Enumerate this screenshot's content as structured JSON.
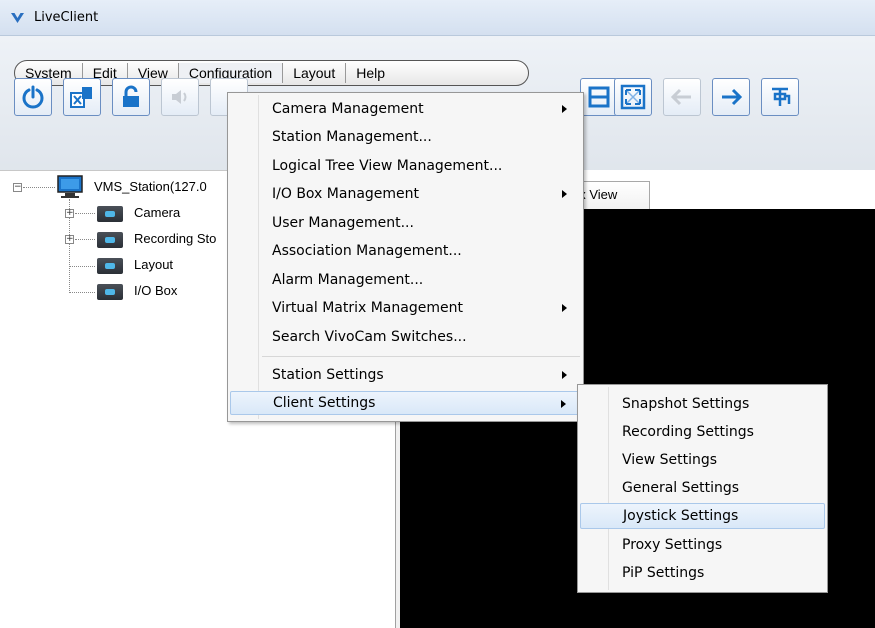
{
  "window": {
    "title": "LiveClient"
  },
  "menubar": {
    "items": [
      "System",
      "Edit",
      "View",
      "Configuration",
      "Layout",
      "Help"
    ]
  },
  "tree": {
    "root": "VMS_Station(127.0",
    "children": [
      "Camera",
      "Recording Sto",
      "Layout",
      "I/O Box"
    ]
  },
  "view_tab": {
    "label": "rix View"
  },
  "config_menu": {
    "items": [
      {
        "label": "Camera Management",
        "submenu": true
      },
      {
        "label": "Station Management...",
        "submenu": false
      },
      {
        "label": "Logical Tree View Management...",
        "submenu": false
      },
      {
        "label": "I/O Box Management",
        "submenu": true
      },
      {
        "label": "User Management...",
        "submenu": false
      },
      {
        "label": "Association Management...",
        "submenu": false
      },
      {
        "label": "Alarm Management...",
        "submenu": false
      },
      {
        "label": "Virtual Matrix Management",
        "submenu": true
      },
      {
        "label": "Search VivoCam Switches...",
        "submenu": false
      },
      {
        "label": "Station Settings",
        "submenu": true
      },
      {
        "label": "Client Settings",
        "submenu": true,
        "highlighted": true
      }
    ]
  },
  "client_settings_menu": {
    "items": [
      {
        "label": "Snapshot Settings"
      },
      {
        "label": "Recording Settings"
      },
      {
        "label": "View Settings"
      },
      {
        "label": "General Settings"
      },
      {
        "label": "Joystick Settings",
        "highlighted": true
      },
      {
        "label": "Proxy Settings"
      },
      {
        "label": "PiP Settings"
      }
    ]
  },
  "toolbar": {
    "icons": [
      "power-icon",
      "logout-icon",
      "lock-icon",
      "speaker-icon",
      "layout-icon",
      "fullscreen-icon",
      "back-arrow-icon",
      "forward-arrow-icon",
      "pin-icon"
    ]
  },
  "colors": {
    "accent": "#1a73c8",
    "highlight": "#d9e8f8",
    "view_bg": "#000000"
  }
}
